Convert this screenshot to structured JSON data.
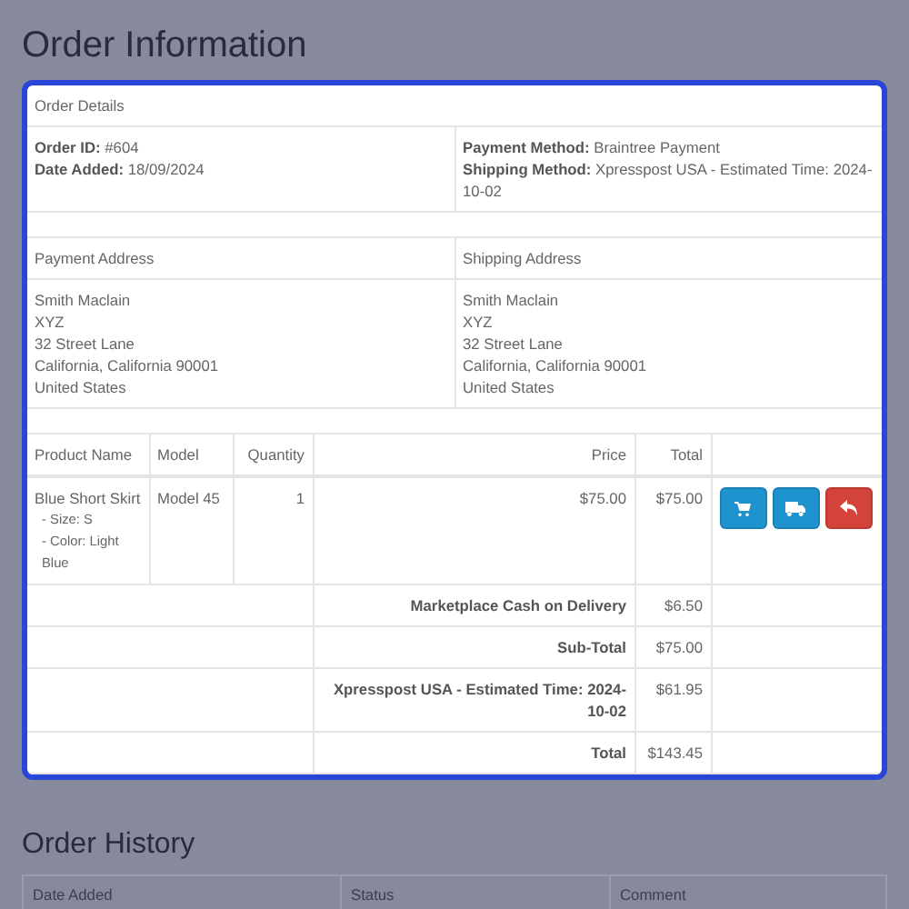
{
  "page_title": "Order Information",
  "order_details": {
    "heading": "Order Details",
    "left": [
      {
        "label": "Order ID:",
        "value": "#604"
      },
      {
        "label": "Date Added:",
        "value": "18/09/2024"
      }
    ],
    "right": [
      {
        "label": "Payment Method:",
        "value": "Braintree Payment"
      },
      {
        "label": "Shipping Method:",
        "value": "Xpresspost USA - Estimated Time: 2024-10-02"
      }
    ]
  },
  "addresses": {
    "columns": [
      "Payment Address",
      "Shipping Address"
    ],
    "lines": [
      [
        "Smith Maclain",
        "XYZ",
        "32 Street Lane",
        "California, California 90001",
        "United States"
      ],
      [
        "Smith Maclain",
        "XYZ",
        "32 Street Lane",
        "California, California 90001",
        "United States"
      ]
    ]
  },
  "products": {
    "columns": [
      "Product Name",
      "Model",
      "Quantity",
      "Price",
      "Total"
    ],
    "rows": [
      {
        "name": "Blue Short Skirt",
        "options": [
          "- Size: S",
          "- Color: Light Blue"
        ],
        "model": "Model 45",
        "quantity": "1",
        "price": "$75.00",
        "total": "$75.00",
        "actions": [
          {
            "kind": "cart"
          },
          {
            "kind": "truck"
          },
          {
            "kind": "return"
          }
        ]
      }
    ],
    "totals": [
      {
        "label": "Marketplace Cash on Delivery",
        "value": "$6.50"
      },
      {
        "label": "Sub-Total",
        "value": "$75.00"
      },
      {
        "label": "Xpresspost USA - Estimated Time: 2024-10-02",
        "value": "$61.95"
      },
      {
        "label": "Total",
        "value": "$143.45"
      }
    ]
  },
  "history": {
    "title": "Order History",
    "columns": [
      "Date Added",
      "Status",
      "Comment"
    ]
  }
}
